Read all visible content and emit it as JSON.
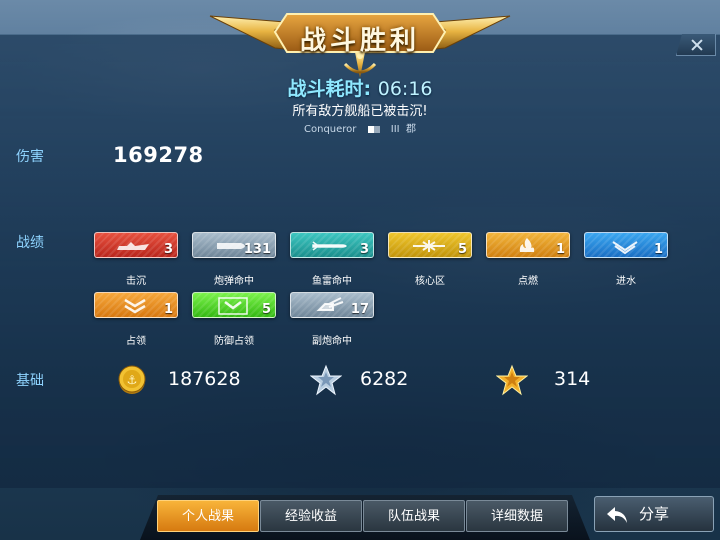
{
  "header": {
    "title": "战斗胜利",
    "time_label": "战斗耗时:",
    "time_value": "06:16",
    "result": "所有敌方舰船已被击沉!",
    "ship_name": "Conqueror",
    "ship_tier": "III",
    "ship_class": "郡"
  },
  "damage": {
    "label": "伤害",
    "value": "169278"
  },
  "achievements": {
    "label": "战绩",
    "items": [
      {
        "label": "击沉",
        "count": "3",
        "color": "#d6382a",
        "icon": "sink-ship-icon"
      },
      {
        "label": "炮弹命中",
        "count": "131",
        "color": "#8da2b4",
        "icon": "shell-icon"
      },
      {
        "label": "鱼雷命中",
        "count": "3",
        "color": "#2aaba8",
        "icon": "torpedo-icon"
      },
      {
        "label": "核心区",
        "count": "5",
        "color": "#dcae18",
        "icon": "citadel-icon"
      },
      {
        "label": "点燃",
        "count": "1",
        "color": "#e89020",
        "icon": "fire-icon"
      },
      {
        "label": "进水",
        "count": "1",
        "color": "#2a8ad8",
        "icon": "flooding-icon"
      },
      {
        "label": "占领",
        "count": "1",
        "color": "#ea8c22",
        "icon": "capture-icon"
      },
      {
        "label": "防御占领",
        "count": "5",
        "color": "#52d82c",
        "icon": "defend-icon"
      },
      {
        "label": "副炮命中",
        "count": "17",
        "color": "#8da2b4",
        "icon": "secondary-icon"
      }
    ]
  },
  "basics": {
    "label": "基础",
    "credits": "187628",
    "experience": "6282",
    "commander_xp": "314"
  },
  "tabs": [
    {
      "label": "个人战果",
      "active": true
    },
    {
      "label": "经验收益",
      "active": false
    },
    {
      "label": "队伍战果",
      "active": false
    },
    {
      "label": "详细数据",
      "active": false
    }
  ],
  "share": {
    "label": "分享"
  }
}
